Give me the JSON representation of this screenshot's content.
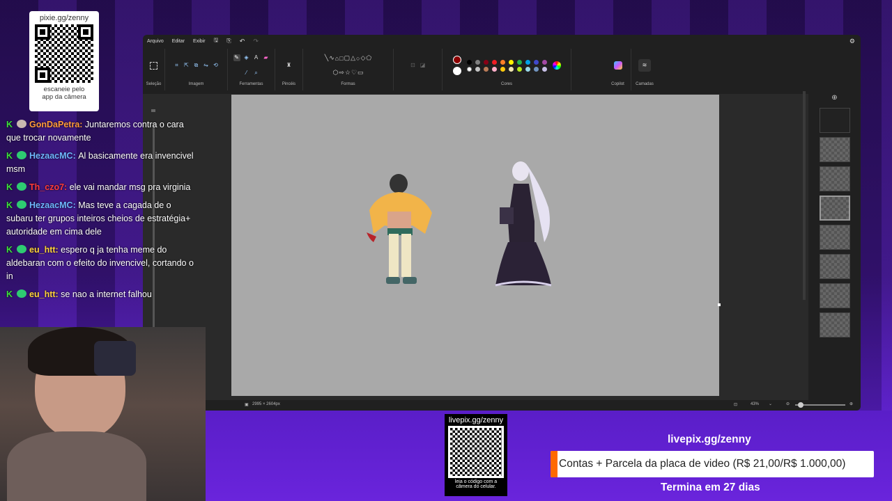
{
  "top_qr": {
    "title": "pixie.gg/zenny",
    "caption_line1": "escaneie pelo",
    "caption_line2": "app da câmera"
  },
  "paint": {
    "menu": [
      "Arquivo",
      "Editar",
      "Exibir"
    ],
    "groups": {
      "selection": "Seleção",
      "image": "Imagem",
      "tools": "Ferramentas",
      "brushes": "Pincéis",
      "shapes": "Formas",
      "colors": "Cores",
      "copilot": "Copilot",
      "layers": "Camadas"
    },
    "status": {
      "dimensions": "2995 × 2604px",
      "zoom": "43%"
    },
    "palette": [
      "#000000",
      "#7f7f7f",
      "#880015",
      "#ed1c24",
      "#ff7f27",
      "#fff200",
      "#22b14c",
      "#00a2e8",
      "#3f48cc",
      "#a349a4",
      "#ffffff",
      "#c3c3c3",
      "#b97a57",
      "#ffaec9",
      "#ffc90e",
      "#efe4b0",
      "#b5e61d",
      "#99d9ea",
      "#7092be",
      "#c8bfe7"
    ],
    "primary_color": "#8b0000",
    "secondary_color": "#ffffff"
  },
  "chat": [
    {
      "user": "GonDaPetra",
      "color": "#ff9a3c",
      "badge": "crown",
      "text": "Juntaremos contra o cara que trocar novamente"
    },
    {
      "user": "HezaacMC",
      "color": "#6fb6ff",
      "badge": "gem",
      "text": "Al basicamente era invencivel msm"
    },
    {
      "user": "Th_czo7",
      "color": "#ff3b3b",
      "badge": "gem",
      "text": "ele vai mandar msg pra virginia"
    },
    {
      "user": "HezaacMC",
      "color": "#6fb6ff",
      "badge": "gem",
      "text": "Mas teve a cagada de o subaru ter grupos inteiros cheios de estratégia+ autoridade em cima dele"
    },
    {
      "user": "eu_htt",
      "color": "#ffd23c",
      "badge": "gem",
      "text": "espero q ja tenha meme do aldebaran com o efeito do invencivel, cortando o in"
    },
    {
      "user": "eu_htt",
      "color": "#ffd23c",
      "badge": "gem",
      "text": "se nao a internet falhou"
    }
  ],
  "bottom_qr": {
    "title": "livepix.gg/zenny",
    "caption_line1": "leia o código com a",
    "caption_line2": "câmera do celular."
  },
  "goal": {
    "site": "livepix.gg/zenny",
    "text": "Contas + Parcela da placa de video (R$ 21,00/R$ 1.000,00)",
    "ends": "Termina em 27 dias",
    "progress": 0.021
  }
}
